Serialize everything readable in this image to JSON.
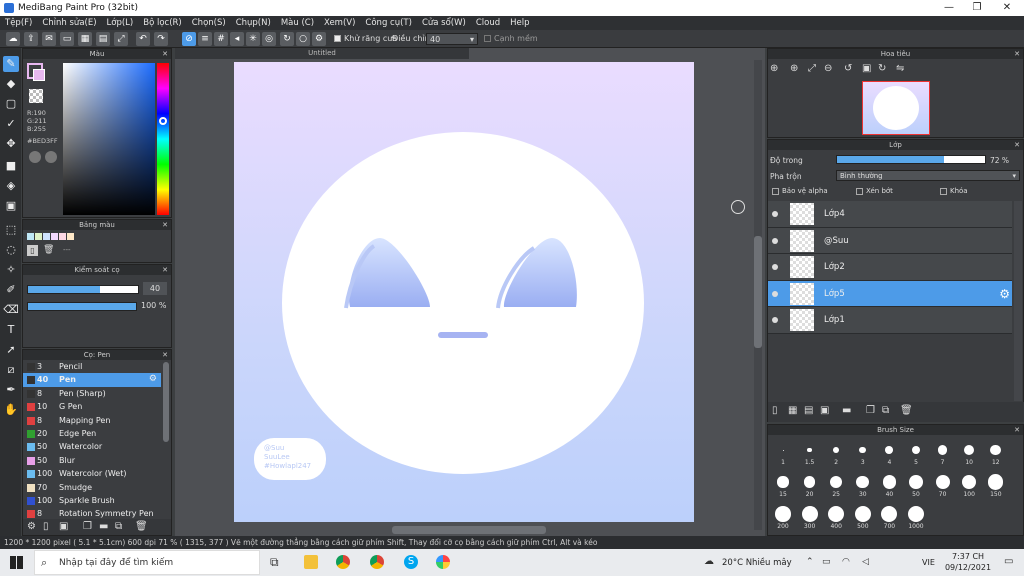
{
  "window": {
    "title": "MediBang Paint Pro (32bit)",
    "controls": [
      "—",
      "❐",
      "✕"
    ]
  },
  "menu": [
    "Tệp(F)",
    "Chỉnh sửa(E)",
    "Lớp(L)",
    "Bộ lọc(R)",
    "Chọn(S)",
    "Chụp(N)",
    "Màu (C)",
    "Xem(V)",
    "Công cụ(T)",
    "Cửa sổ(W)",
    "Cloud",
    "Help"
  ],
  "toolbar": {
    "antialias_label": "Khử răng cưa",
    "adjust_label": "Điều chỉnh",
    "adjust_value": "40",
    "edge_label": "Cạnh mềm"
  },
  "color_panel": {
    "title": "Màu",
    "r": "R:190",
    "g": "G:211",
    "b": "B:255",
    "hex": "#BED3FF",
    "fg": "#e8b8f0",
    "bg": "#ffffff"
  },
  "palette_panel": {
    "title": "Bảng màu",
    "dash": "---"
  },
  "brush_control": {
    "title": "Kiểm soát cọ",
    "size": "40",
    "opacity": "100 %"
  },
  "brush_panel": {
    "title": "Cọ: Pen",
    "items": [
      {
        "size": "3",
        "name": "Pencil",
        "color": "#333333"
      },
      {
        "size": "40",
        "name": "Pen",
        "color": "#333333"
      },
      {
        "size": "8",
        "name": "Pen (Sharp)",
        "color": "#333333"
      },
      {
        "size": "10",
        "name": "G Pen",
        "color": "#e04040"
      },
      {
        "size": "8",
        "name": "Mapping Pen",
        "color": "#e04040"
      },
      {
        "size": "20",
        "name": "Edge Pen",
        "color": "#30a030"
      },
      {
        "size": "50",
        "name": "Watercolor",
        "color": "#6bbcef"
      },
      {
        "size": "50",
        "name": "Blur",
        "color": "#e8a0e8"
      },
      {
        "size": "100",
        "name": "Watercolor (Wet)",
        "color": "#6bbcef"
      },
      {
        "size": "70",
        "name": "Smudge",
        "color": "#f0e0c0"
      },
      {
        "size": "100",
        "name": "Sparkle Brush",
        "color": "#3050d0"
      },
      {
        "size": "8",
        "name": "Rotation Symmetry Pen",
        "color": "#e04040"
      }
    ],
    "selected_index": 1
  },
  "canvas": {
    "tab_title": "Untitled",
    "signature": [
      "@Suu",
      "SuuLee",
      "#Howlapl247"
    ]
  },
  "navigator": {
    "title": "Hoa tiêu"
  },
  "layer_panel": {
    "title": "Lớp",
    "opacity_label": "Độ trong",
    "opacity_value": "72 %",
    "opacity": 0.72,
    "blend_label": "Pha trộn",
    "blend_value": "Bình thường",
    "protect_alpha": "Bảo vệ alpha",
    "clipping": "Xén bớt",
    "lock": "Khóa",
    "layers": [
      {
        "name": "Lớp4"
      },
      {
        "name": "@Suu"
      },
      {
        "name": "Lớp2"
      },
      {
        "name": "Lớp5"
      },
      {
        "name": "Lớp1"
      }
    ],
    "selected_index": 3
  },
  "brush_size_panel": {
    "title": "Brush Size",
    "sizes": [
      "1",
      "1.5",
      "2",
      "3",
      "4",
      "5",
      "7",
      "10",
      "12",
      "15",
      "20",
      "25",
      "30",
      "40",
      "50",
      "70",
      "100",
      "150",
      "200",
      "300",
      "400",
      "500",
      "700",
      "1000"
    ]
  },
  "status": {
    "text": "1200 * 1200 pixel  ( 5.1 * 5.1cm)  600 dpi  71 %  ( 1315, 377 )  Vẽ một đường thẳng bằng cách giữ phím Shift, Thay đổi cỡ cọ bằng cách giữ phím Ctrl, Alt và kéo"
  },
  "taskbar": {
    "search_placeholder": "Nhập tại đây để tìm kiếm",
    "weather": "20°C  Nhiều mây",
    "lang": "VIE",
    "time": "7:37 CH",
    "date": "09/12/2021"
  }
}
